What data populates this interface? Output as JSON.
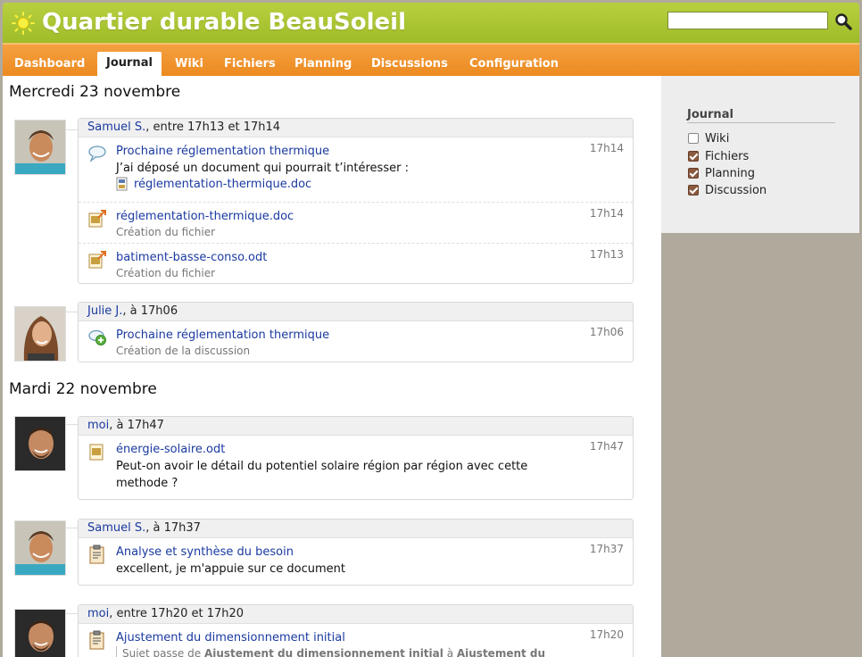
{
  "app": {
    "title": "Quartier durable BeauSoleil"
  },
  "search": {
    "placeholder": ""
  },
  "nav": {
    "tabs": [
      {
        "label": "Dashboard"
      },
      {
        "label": "Journal"
      },
      {
        "label": "Wiki"
      },
      {
        "label": "Fichiers"
      },
      {
        "label": "Planning"
      },
      {
        "label": "Discussions"
      },
      {
        "label": "Configuration"
      }
    ]
  },
  "sidebar": {
    "title": "Journal",
    "filters": [
      {
        "label": "Wiki",
        "checked": false
      },
      {
        "label": "Fichiers",
        "checked": true
      },
      {
        "label": "Planning",
        "checked": true
      },
      {
        "label": "Discussion",
        "checked": true
      }
    ]
  },
  "days": [
    {
      "label": "Mercredi 23 novembre"
    },
    {
      "label": "Mardi 22 novembre"
    }
  ],
  "groups": [
    {
      "author": "Samuel S.",
      "when": ", entre 17h13 et 17h14",
      "entries": [
        {
          "title": "Prochaine réglementation thermique",
          "time": "17h14",
          "body": "J’ai déposé un document qui pourrait t’intéresser :",
          "attachment": "réglementation-thermique.doc"
        },
        {
          "title": "réglementation-thermique.doc",
          "time": "17h14",
          "sub": "Création du fichier"
        },
        {
          "title": "batiment-basse-conso.odt",
          "time": "17h13",
          "sub": "Création du fichier"
        }
      ]
    },
    {
      "author": "Julie J.",
      "when": ", à 17h06",
      "entries": [
        {
          "title": "Prochaine réglementation thermique",
          "time": "17h06",
          "sub": "Création de la discussion"
        }
      ]
    },
    {
      "author": "moi",
      "when": ", à 17h47",
      "entries": [
        {
          "title": "énergie-solaire.odt",
          "time": "17h47",
          "body1": "Peut-on avoir le détail du potentiel solaire région par région avec cette",
          "body2": "methode ?"
        }
      ]
    },
    {
      "author": "Samuel S.",
      "when": ", à 17h37",
      "entries": [
        {
          "title": "Analyse et synthèse du besoin",
          "time": "17h37",
          "body": "excellent, je m'appuie sur ce document"
        }
      ]
    },
    {
      "author": "moi",
      "when": ", entre 17h20 et 17h20",
      "entries": [
        {
          "title": "Ajustement du dimensionnement initial",
          "time": "17h20",
          "sub_a": "Sujet passe de ",
          "sub_b": "Ajustement du dimensionnement initial",
          "sub_c": " à ",
          "sub_d": "Ajustement du"
        }
      ]
    }
  ],
  "colors": {
    "header": "#a6c22e",
    "nav": "#ee8e24",
    "link": "#1a3aa0",
    "sidebar_bg": "#b0aa9c"
  }
}
